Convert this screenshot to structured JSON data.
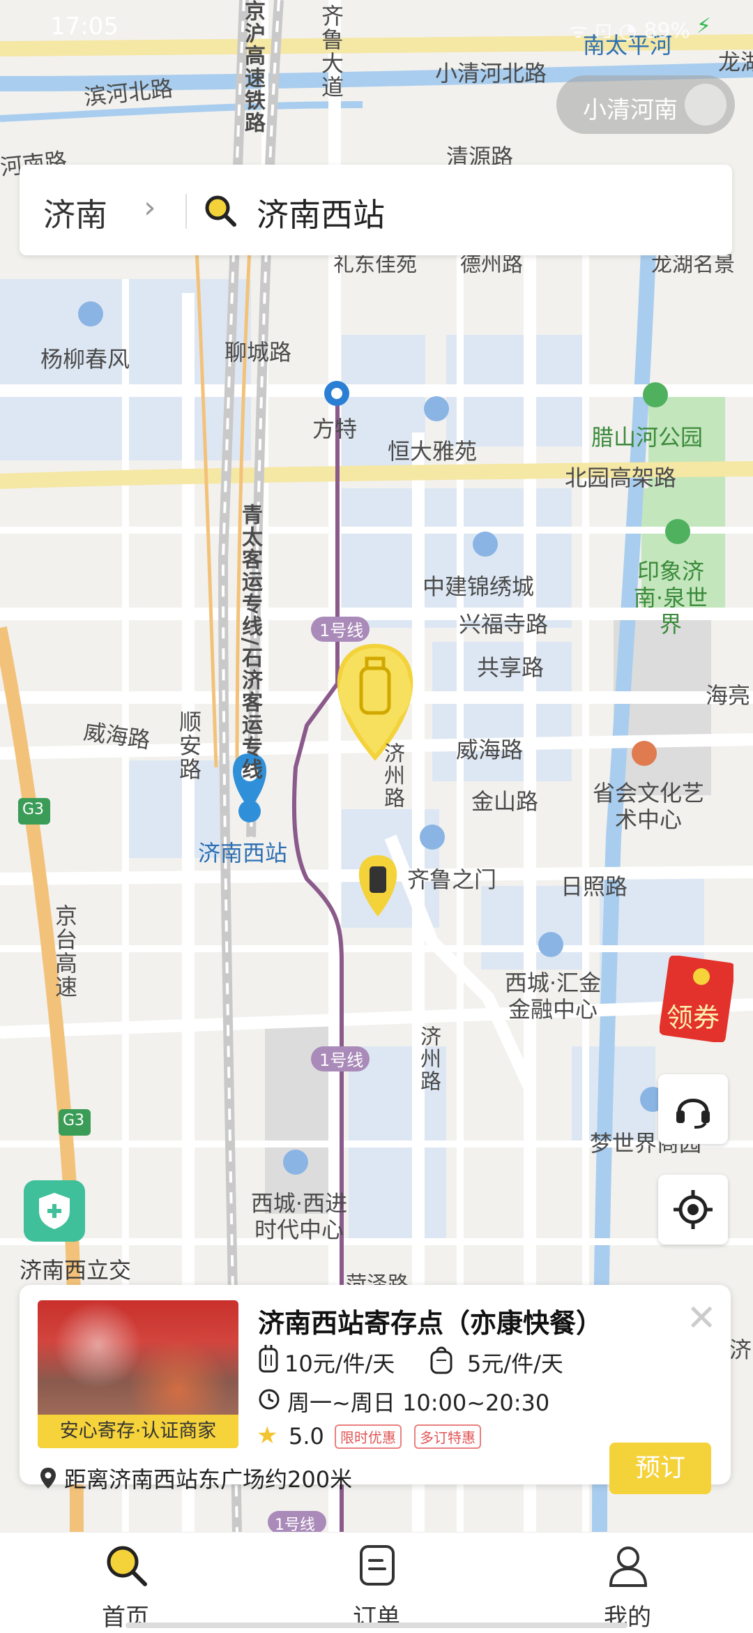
{
  "status_bar": {
    "time": "17:05",
    "icons": "ᯤ ⊡ ◔ 89%"
  },
  "search": {
    "city": "济南",
    "query": "济南西站"
  },
  "metro_toggle": {
    "label": "小清河南"
  },
  "map_labels": {
    "south_taiping": "南太平河",
    "longhu": "龙湖",
    "xiaoqinghe_north_rd": "小清河北路",
    "binhe_north_rd": "滨河北路",
    "hebin_rd": "河南路",
    "qingyuan_rd": "清源路",
    "jinghu_railway": "京沪高速铁路",
    "qilu_avenue": "齐鲁大道",
    "lidong_jiayuan": "礼东佳苑",
    "dezhou_rd": "德州路",
    "longhu_mingjing": "龙湖名景",
    "yangliu_chunfeng": "杨柳春风",
    "liaocheng_rd": "聊城路",
    "fangte": "方特",
    "hengda_yayuan": "恒大雅苑",
    "lashanhe_park": "腊山河公园",
    "beiyuan_viaduct": "北园高架路",
    "qingtai_line": "青太客运专线/石济客运专线",
    "zhongjian_jinxiucheng": "中建锦绣城",
    "yinxiang_jinan": "印象济南·泉世界",
    "xingfusi_rd": "兴福寺路",
    "line1_upper": "1号线",
    "gongxiang_rd": "共享路",
    "hailiang": "海亮",
    "weihai_rd_west": "威海路",
    "shunan_rd": "顺安路",
    "jizhou_rd": "济州路",
    "weihai_rd_east": "威海路",
    "jinshan_rd": "金山路",
    "provincial_culture": "省会文化艺术中心",
    "jinan_west_station": "济南西站",
    "qilu_gate": "齐鲁之门",
    "rizhao_rd": "日照路",
    "g3_upper": "G3",
    "jingtai_highway": "京台高速",
    "xicheng_finance": "西城·汇金金融中心",
    "line1_lower": "1号线",
    "jizhou_rd_2": "济州路",
    "g3_lower": "G3",
    "mengshijie": "梦世界商园",
    "xicheng_xijin": "西城·西进时代中心",
    "heze_rd": "菏泽路",
    "jinan_west_interchange": "济南西立交",
    "ji_right": "济",
    "line1_bottom": "1号线"
  },
  "red_packet": {
    "label": "领券"
  },
  "shop_card": {
    "title": "济南西站寄存点（亦康快餐）",
    "badge": "安心寄存·认证商家",
    "price_large": "10元/件/天",
    "price_small": "5元/件/天",
    "hours": "周一~周日 10:00~20:30",
    "rating": "5.0",
    "tag_discount": "限时优惠",
    "tag_multi": "多订特惠",
    "distance": "距离济南西站东广场约200米",
    "book_label": "预订"
  },
  "tabs": [
    {
      "label": "首页",
      "icon": "search-icon",
      "active": true
    },
    {
      "label": "订单",
      "icon": "order-icon",
      "active": false
    },
    {
      "label": "我的",
      "icon": "profile-icon",
      "active": false
    }
  ],
  "colors": {
    "brand_yellow": "#f4d23a",
    "metro_purple": "#8a5a8a",
    "water_blue": "#a9cdee",
    "park_green": "#9fd89a",
    "highway_orange": "#f3c27a"
  }
}
